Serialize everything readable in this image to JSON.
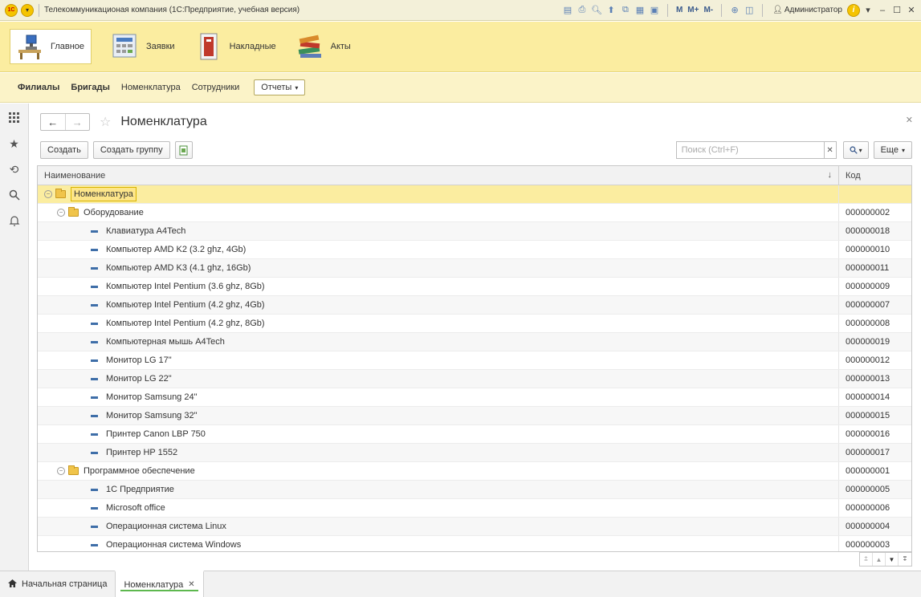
{
  "titlebar": {
    "logo": "1С",
    "title": "Телекоммуникационая компания  (1С:Предприятие, учебная версия)",
    "tools": [
      "list-icon",
      "print-icon",
      "preview-icon",
      "save-icon",
      "copy-icon",
      "calculator-icon",
      "calendar-icon"
    ],
    "memory": [
      "M",
      "M+",
      "M-"
    ],
    "user": "Администратор",
    "info": "i"
  },
  "sections": [
    {
      "label": "Главное",
      "icon": "desk-icon",
      "active": true
    },
    {
      "label": "Заявки",
      "icon": "calculator-doc-icon"
    },
    {
      "label": "Накладные",
      "icon": "binder-icon"
    },
    {
      "label": "Акты",
      "icon": "books-icon"
    }
  ],
  "navpanel": {
    "links": [
      {
        "label": "Филиалы",
        "bold": true
      },
      {
        "label": "Бригады",
        "bold": true
      },
      {
        "label": "Номенклатура",
        "bold": false
      },
      {
        "label": "Сотрудники",
        "bold": false
      }
    ],
    "reports": "Отчеты"
  },
  "sidebar": [
    "grid-icon",
    "star-icon",
    "history-icon",
    "search-icon",
    "bell-icon"
  ],
  "form": {
    "title": "Номенклатура",
    "buttons": {
      "create": "Создать",
      "create_group": "Создать группу",
      "more": "Еще"
    },
    "search_placeholder": "Поиск (Ctrl+F)"
  },
  "table": {
    "columns": {
      "name": "Наименование",
      "code": "Код"
    },
    "rows": [
      {
        "level": 0,
        "type": "group",
        "name": "Номенклатура",
        "code": ""
      },
      {
        "level": 1,
        "type": "group",
        "name": "Оборудование",
        "code": "000000002"
      },
      {
        "level": 2,
        "type": "item",
        "name": "Клавиатура A4Tech",
        "code": "000000018"
      },
      {
        "level": 2,
        "type": "item",
        "name": "Компьютер AMD K2 (3.2 ghz, 4Gb)",
        "code": "000000010"
      },
      {
        "level": 2,
        "type": "item",
        "name": "Компьютер AMD K3 (4.1 ghz, 16Gb)",
        "code": "000000011"
      },
      {
        "level": 2,
        "type": "item",
        "name": "Компьютер Intel Pentium (3.6 ghz, 8Gb)",
        "code": "000000009"
      },
      {
        "level": 2,
        "type": "item",
        "name": "Компьютер Intel Pentium (4.2 ghz, 4Gb)",
        "code": "000000007"
      },
      {
        "level": 2,
        "type": "item",
        "name": "Компьютер Intel Pentium (4.2 ghz, 8Gb)",
        "code": "000000008"
      },
      {
        "level": 2,
        "type": "item",
        "name": "Компьютерная мышь A4Tech",
        "code": "000000019"
      },
      {
        "level": 2,
        "type": "item",
        "name": "Монитор LG 17\"",
        "code": "000000012"
      },
      {
        "level": 2,
        "type": "item",
        "name": "Монитор LG 22\"",
        "code": "000000013"
      },
      {
        "level": 2,
        "type": "item",
        "name": "Монитор Samsung 24\"",
        "code": "000000014"
      },
      {
        "level": 2,
        "type": "item",
        "name": "Монитор Samsung 32\"",
        "code": "000000015"
      },
      {
        "level": 2,
        "type": "item",
        "name": "Принтер Canon LBP 750",
        "code": "000000016"
      },
      {
        "level": 2,
        "type": "item",
        "name": "Принтер HP 1552",
        "code": "000000017"
      },
      {
        "level": 1,
        "type": "group",
        "name": "Программное обеспечение",
        "code": "000000001"
      },
      {
        "level": 2,
        "type": "item",
        "name": "1С Предприятие",
        "code": "000000005"
      },
      {
        "level": 2,
        "type": "item",
        "name": "Microsoft office",
        "code": "000000006"
      },
      {
        "level": 2,
        "type": "item",
        "name": "Операционная система Linux",
        "code": "000000004"
      },
      {
        "level": 2,
        "type": "item",
        "name": "Операционная система Windows",
        "code": "000000003"
      }
    ]
  },
  "bottombar": {
    "home": "Начальная страница",
    "open_tab": "Номенклатура"
  }
}
